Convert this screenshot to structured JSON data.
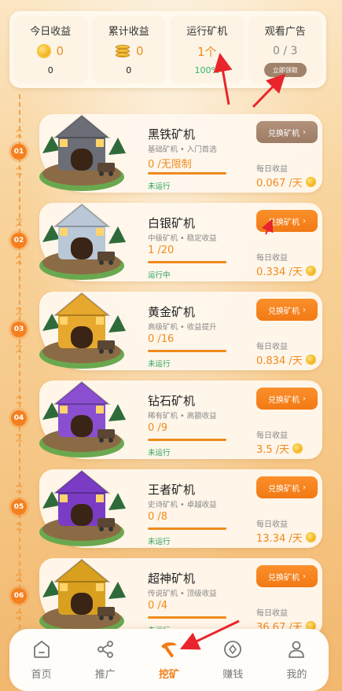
{
  "stats": [
    {
      "title": "今日收益",
      "value": "0",
      "bottom": "0",
      "icon": "gold-coin-icon"
    },
    {
      "title": "累计收益",
      "value": "0",
      "bottom": "0",
      "icon": "coin-stack-icon"
    },
    {
      "title": "运行矿机",
      "value": "1个",
      "bottom": "100%"
    },
    {
      "title": "观看广告",
      "value": "0 / 3",
      "button": "立即领取"
    }
  ],
  "steps": [
    "01",
    "02",
    "03",
    "04",
    "05",
    "06"
  ],
  "machines": [
    {
      "name": "黑铁矿机",
      "desc": "基础矿机 • 入门首选",
      "cap": "0 /无限制",
      "status": "未运行",
      "button": "兑换矿机",
      "daily_label": "每日收益",
      "daily": "0.067 /天",
      "color": "#6b6e76"
    },
    {
      "name": "白银矿机",
      "desc": "中级矿机 • 稳定收益",
      "cap": "1 /20",
      "status": "运行中",
      "button": "兑换矿机",
      "daily_label": "每日收益",
      "daily": "0.334 /天",
      "color": "#b9c7d6"
    },
    {
      "name": "黄金矿机",
      "desc": "高级矿机 • 收益提升",
      "cap": "0 /16",
      "status": "未运行",
      "button": "兑换矿机",
      "daily_label": "每日收益",
      "daily": "0.834 /天",
      "color": "#e7a82e"
    },
    {
      "name": "钻石矿机",
      "desc": "稀有矿机 • 高额收益",
      "cap": "0 /9",
      "status": "未运行",
      "button": "兑换矿机",
      "daily_label": "每日收益",
      "daily": "3.5 /天",
      "color": "#8a4fd0"
    },
    {
      "name": "王者矿机",
      "desc": "史诗矿机 • 卓越收益",
      "cap": "0 /8",
      "status": "未运行",
      "button": "兑换矿机",
      "daily_label": "每日收益",
      "daily": "13.34 /天",
      "color": "#7a3cc4"
    },
    {
      "name": "超神矿机",
      "desc": "传说矿机 • 顶级收益",
      "cap": "0 /4",
      "status": "未运行",
      "button": "兑换矿机",
      "daily_label": "每日收益",
      "daily": "36.67 /天",
      "color": "#d9a020"
    }
  ],
  "nav": [
    {
      "label": "首页",
      "icon": "home-icon"
    },
    {
      "label": "推广",
      "icon": "share-icon"
    },
    {
      "label": "挖矿",
      "icon": "pickaxe-icon",
      "active": true
    },
    {
      "label": "赚钱",
      "icon": "coin-icon"
    },
    {
      "label": "我的",
      "icon": "user-icon"
    }
  ],
  "colors": {
    "accent": "#f27a15",
    "status_green": "#2aa35a",
    "annotation_red": "#e8252d"
  }
}
